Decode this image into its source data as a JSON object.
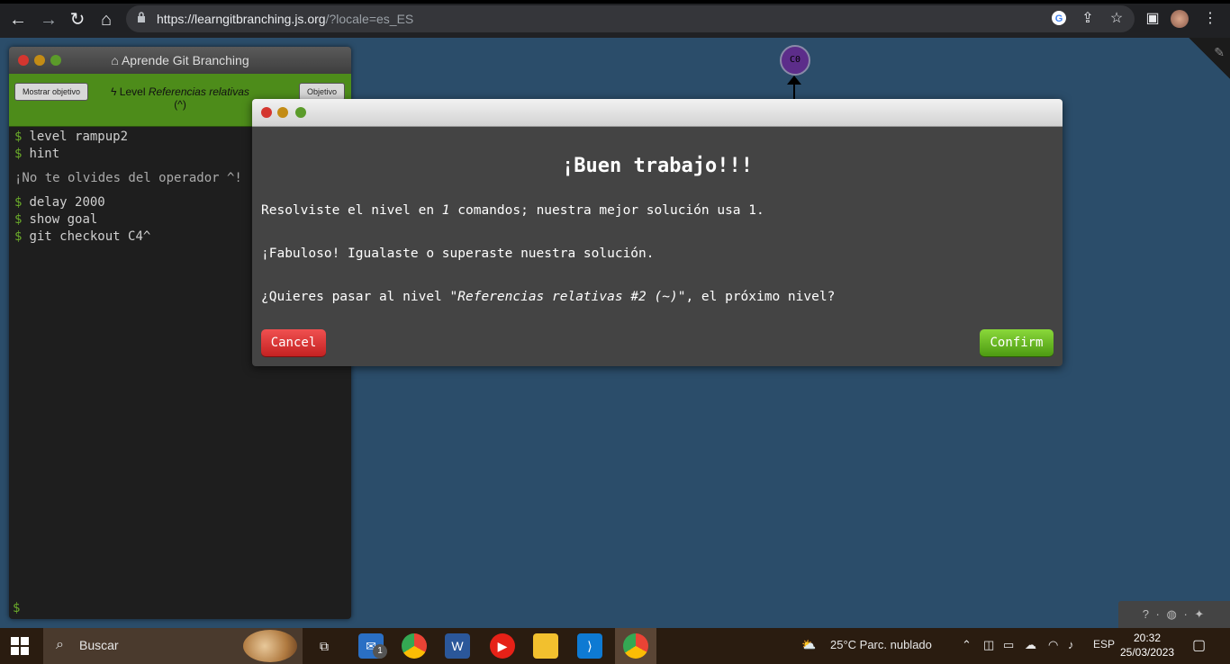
{
  "browser": {
    "url_host": "https://learngitbranching.js.org",
    "url_rest": "/?locale=es_ES"
  },
  "commit_node": {
    "label": "C0"
  },
  "terminal": {
    "title": "Aprende Git Branching",
    "show_goal_button": "Mostrar objetivo",
    "level_prefix": "Level",
    "level_name": "Referencias relativas",
    "level_suffix": "(^)",
    "goal_button": "Objetivo",
    "commands_before": [
      "level rampup2",
      "hint"
    ],
    "message": "¡No te olvides del operador ^!",
    "commands_after": [
      "delay 2000",
      "show goal",
      "git checkout C4^"
    ],
    "prompt": "$"
  },
  "modal": {
    "heading": "¡Buen trabajo!!!",
    "line1_a": "Resolviste el nivel en",
    "line1_count": "1",
    "line1_b": "comandos; nuestra mejor solución usa 1.",
    "line2": "¡Fabuloso! Igualaste o superaste nuestra solución.",
    "line3_a": "¿Quieres pasar al nivel",
    "line3_level": "\"Referencias relativas #2 (~)\"",
    "line3_b": ", el próximo nivel?",
    "cancel_label": "Cancel",
    "confirm_label": "Confirm"
  },
  "taskbar": {
    "search_label": "Buscar",
    "mail_badge": "1",
    "weather": "25°C  Parc. nublado",
    "language": "ESP",
    "time": "20:32",
    "date": "25/03/2023"
  }
}
